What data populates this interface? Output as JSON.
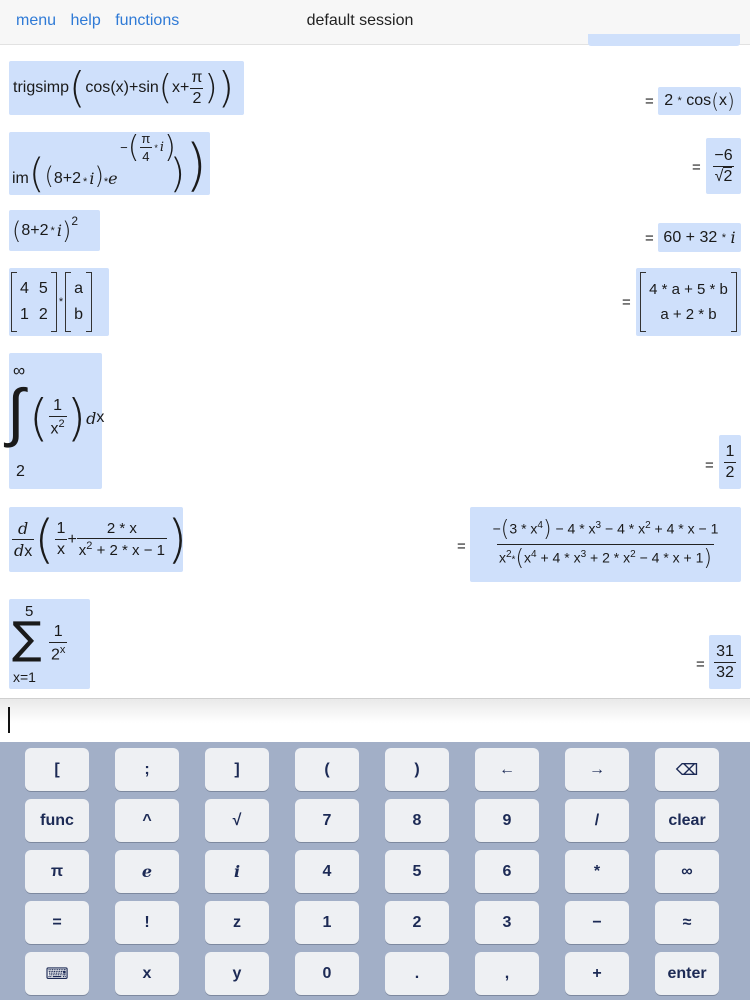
{
  "nav": {
    "menu": "menu",
    "help": "help",
    "functions": "functions"
  },
  "session": {
    "title": "default session"
  },
  "entries": {
    "e1": {
      "func": "trigsimp",
      "cos": "cos",
      "x": "x",
      "plus": "+",
      "sin": "sin",
      "pi": "π",
      "two": "2",
      "eq": "=",
      "r_coef": "2",
      "r_op": "*",
      "r_func": "cos",
      "r_arg": "x"
    },
    "e2": {
      "func": "im",
      "a": "8",
      "plus": "+",
      "b": "2",
      "op": "*",
      "i": "i",
      "op2": "*",
      "e": "e",
      "minus": "−",
      "pi": "π",
      "four": "4",
      "op3": "*",
      "i2": "i",
      "eq": "=",
      "r_num": "−6",
      "r_den": "2",
      "r_sqrt": "√"
    },
    "e3": {
      "a": "8",
      "plus": "+",
      "b": "2",
      "op": "*",
      "i": "i",
      "pow": "2",
      "eq": "=",
      "r_a": "60",
      "r_plus": "+",
      "r_b": "32",
      "r_op": "*",
      "r_i": "i"
    },
    "e4": {
      "m11": "4",
      "m12": "5",
      "m21": "1",
      "m22": "2",
      "op": "*",
      "v1": "a",
      "v2": "b",
      "eq": "=",
      "r1": "4 * a + 5 * b",
      "r2": "a + 2 * b"
    },
    "e5": {
      "upper": "∞",
      "lower": "2",
      "int": "∫",
      "one": "1",
      "x": "x",
      "pow": "2",
      "d": "d",
      "dx": "x",
      "eq": "=",
      "r_num": "1",
      "r_den": "2"
    },
    "e6": {
      "d": "d",
      "dx": "d",
      "x": "x",
      "one": "1",
      "xden": "x",
      "plus": "+",
      "num": "2 * x",
      "den_x": "x",
      "den_pow": "2",
      "den_rest": "+ 2 * x − 1",
      "eq": "=",
      "r_num_neg": "−",
      "r_num_a": "3 * x",
      "r_num_a_pow": "4",
      "r_num_b": "− 4 * x",
      "r_num_b_pow": "3",
      "r_num_c": "− 4 * x",
      "r_num_c_pow": "2",
      "r_num_d": "+ 4 * x − 1",
      "r_den_x": "x",
      "r_den_x_pow": "2",
      "r_den_op": "*",
      "r_den_a": "x",
      "r_den_a_pow": "4",
      "r_den_b": "+ 4 * x",
      "r_den_b_pow": "3",
      "r_den_c": "+ 2 * x",
      "r_den_c_pow": "2",
      "r_den_d": "− 4 * x + 1"
    },
    "e7": {
      "upper": "5",
      "sigma": "∑",
      "lower": "x=1",
      "one": "1",
      "two": "2",
      "pow": "x",
      "eq": "=",
      "r_num": "31",
      "r_den": "32"
    }
  },
  "keyboard": {
    "row1": [
      "[",
      ";",
      "]",
      "(",
      ")",
      "←",
      "→",
      "⌫"
    ],
    "row2": [
      "func",
      "^",
      "√",
      "7",
      "8",
      "9",
      "/",
      "clear"
    ],
    "row3": [
      "π",
      "e",
      "i",
      "4",
      "5",
      "6",
      "*",
      "∞"
    ],
    "row4": [
      "=",
      "!",
      "z",
      "1",
      "2",
      "3",
      "−",
      "≈"
    ],
    "row5": [
      "⌨",
      "x",
      "y",
      "0",
      ".",
      ",",
      "+",
      "enter"
    ]
  }
}
